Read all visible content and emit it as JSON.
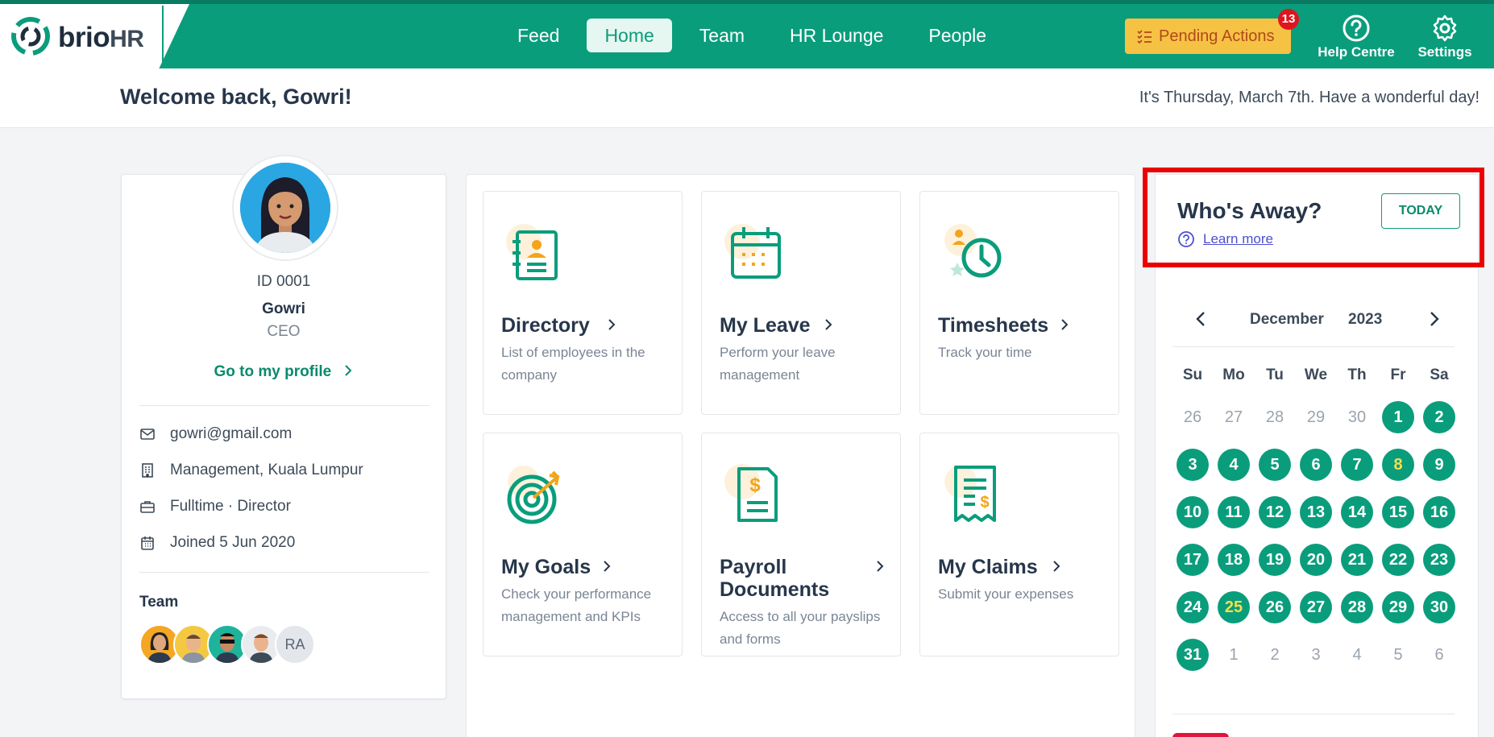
{
  "brand": {
    "name_a": "brio",
    "name_b": "HR"
  },
  "nav": {
    "items": [
      {
        "label": "Feed",
        "active": false
      },
      {
        "label": "Home",
        "active": true
      },
      {
        "label": "Team",
        "active": false
      },
      {
        "label": "HR Lounge",
        "active": false
      },
      {
        "label": "People",
        "active": false
      }
    ],
    "pending_label": "Pending Actions",
    "pending_count": "13",
    "help_label": "Help Centre",
    "settings_label": "Settings"
  },
  "welcome": {
    "greeting": "Welcome back, Gowri!",
    "date_text": "It's Thursday, March 7th. Have a wonderful day!"
  },
  "profile": {
    "id": "ID 0001",
    "name": "Gowri",
    "role": "CEO",
    "link": "Go to my profile",
    "email": "gowri@gmail.com",
    "location": "Management, Kuala Lumpur",
    "employment": "Fulltime · Director",
    "joined": "Joined 5 Jun 2020",
    "team_label": "Team",
    "team_extra_initials": "RA"
  },
  "tiles": [
    {
      "title": "Directory",
      "desc": "List of employees in the company",
      "icon": "directory-icon"
    },
    {
      "title": "My Leave",
      "desc": "Perform your leave management",
      "icon": "calendar-icon"
    },
    {
      "title": "Timesheets",
      "desc": "Track your time",
      "icon": "clock-icon"
    },
    {
      "title": "My Goals",
      "desc": "Check your performance management and KPIs",
      "icon": "target-icon"
    },
    {
      "title": "Payroll Documents",
      "desc": "Access to all your payslips and forms",
      "icon": "payroll-icon"
    },
    {
      "title": "My Claims",
      "desc": "Submit your expenses",
      "icon": "receipt-icon"
    }
  ],
  "whos_away": {
    "title": "Who's Away?",
    "help": "Learn more",
    "today": "TODAY"
  },
  "calendar": {
    "month": "December",
    "year": "2023",
    "weekdays": [
      "Su",
      "Mo",
      "Tu",
      "We",
      "Th",
      "Fr",
      "Sa"
    ],
    "weeks": [
      [
        "26",
        "27",
        "28",
        "29",
        "30",
        "1",
        "2"
      ],
      [
        "3",
        "4",
        "5",
        "6",
        "7",
        "8",
        "9"
      ],
      [
        "10",
        "11",
        "12",
        "13",
        "14",
        "15",
        "16"
      ],
      [
        "17",
        "18",
        "19",
        "20",
        "21",
        "22",
        "23"
      ],
      [
        "24",
        "25",
        "26",
        "27",
        "28",
        "29",
        "30"
      ],
      [
        "31",
        "1",
        "2",
        "3",
        "4",
        "5",
        "6"
      ]
    ],
    "highlighted_days": [
      "8",
      "25"
    ],
    "accent": "#0a9d7c"
  },
  "colors": {
    "primary": "#0a9d7c",
    "pending": "#f6c244",
    "badge": "#e0141e",
    "highlight_frame": "#ec0000"
  }
}
